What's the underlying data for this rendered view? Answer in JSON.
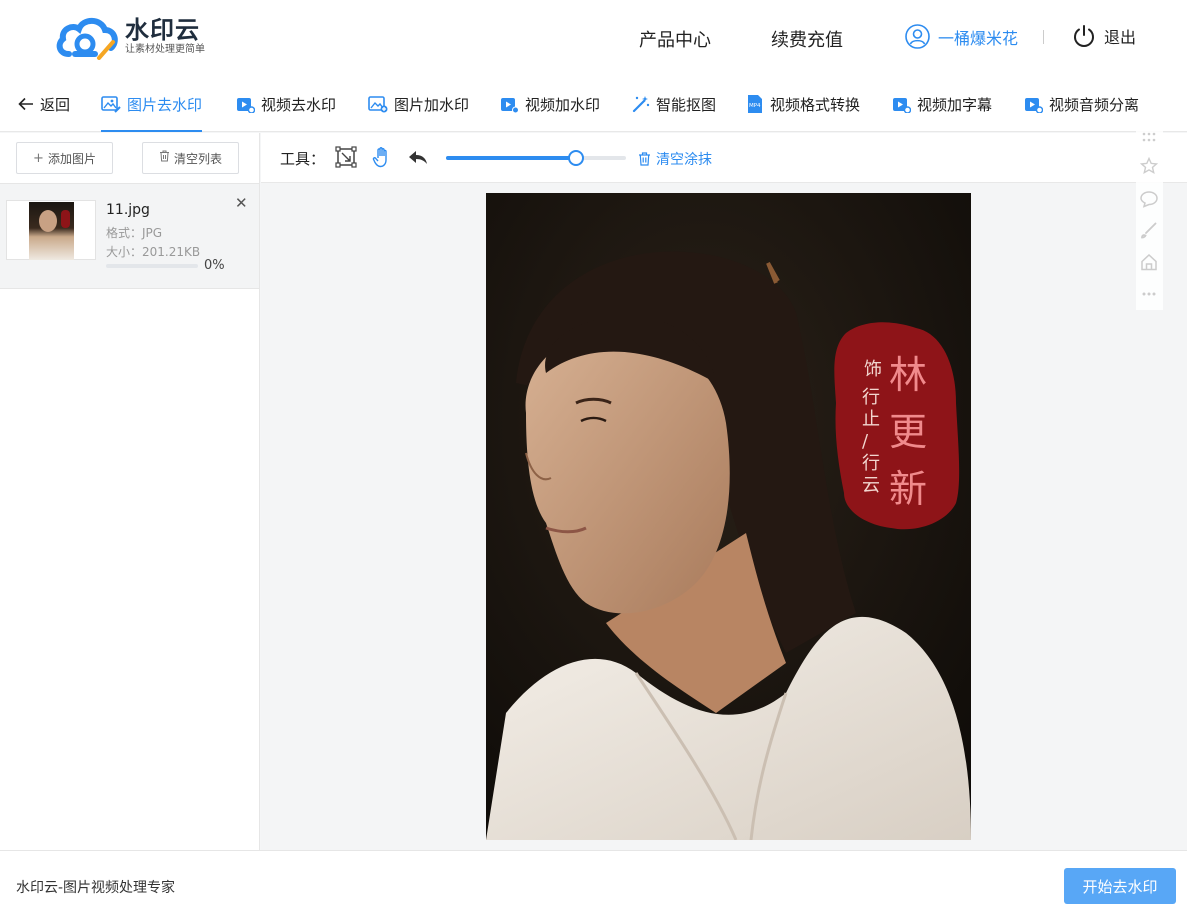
{
  "header": {
    "logo_title": "水印云",
    "logo_sub": "让素材处理更简单",
    "nav": [
      "产品中心",
      "续费充值"
    ],
    "username": "一桶爆米花",
    "logout": "退出"
  },
  "tabs": {
    "back": "返回",
    "items": [
      "图片去水印",
      "视频去水印",
      "图片加水印",
      "视频加水印",
      "智能抠图",
      "视频格式转换",
      "视频加字幕",
      "视频音频分离"
    ],
    "active_index": 0
  },
  "left": {
    "add_button": "添加图片",
    "clear_list_button": "清空列表",
    "file": {
      "name": "11.jpg",
      "format": "格式：JPG",
      "size": "大小：201.21KB",
      "progress_text": "0%",
      "progress": 0
    }
  },
  "toolbar": {
    "label": "工具：",
    "brush_size": 0.72,
    "clear_paint": "清空涂抹"
  },
  "photo": {
    "seal_name": "林更新",
    "seal_role_1": "饰",
    "seal_role_2": "行止/行云"
  },
  "footer": {
    "text": "水印云-图片视频处理专家",
    "start_button": "开始去水印"
  },
  "colors": {
    "accent": "#2d8cf0",
    "start_button": "#58a7f6",
    "seal_red": "#8e1418"
  }
}
